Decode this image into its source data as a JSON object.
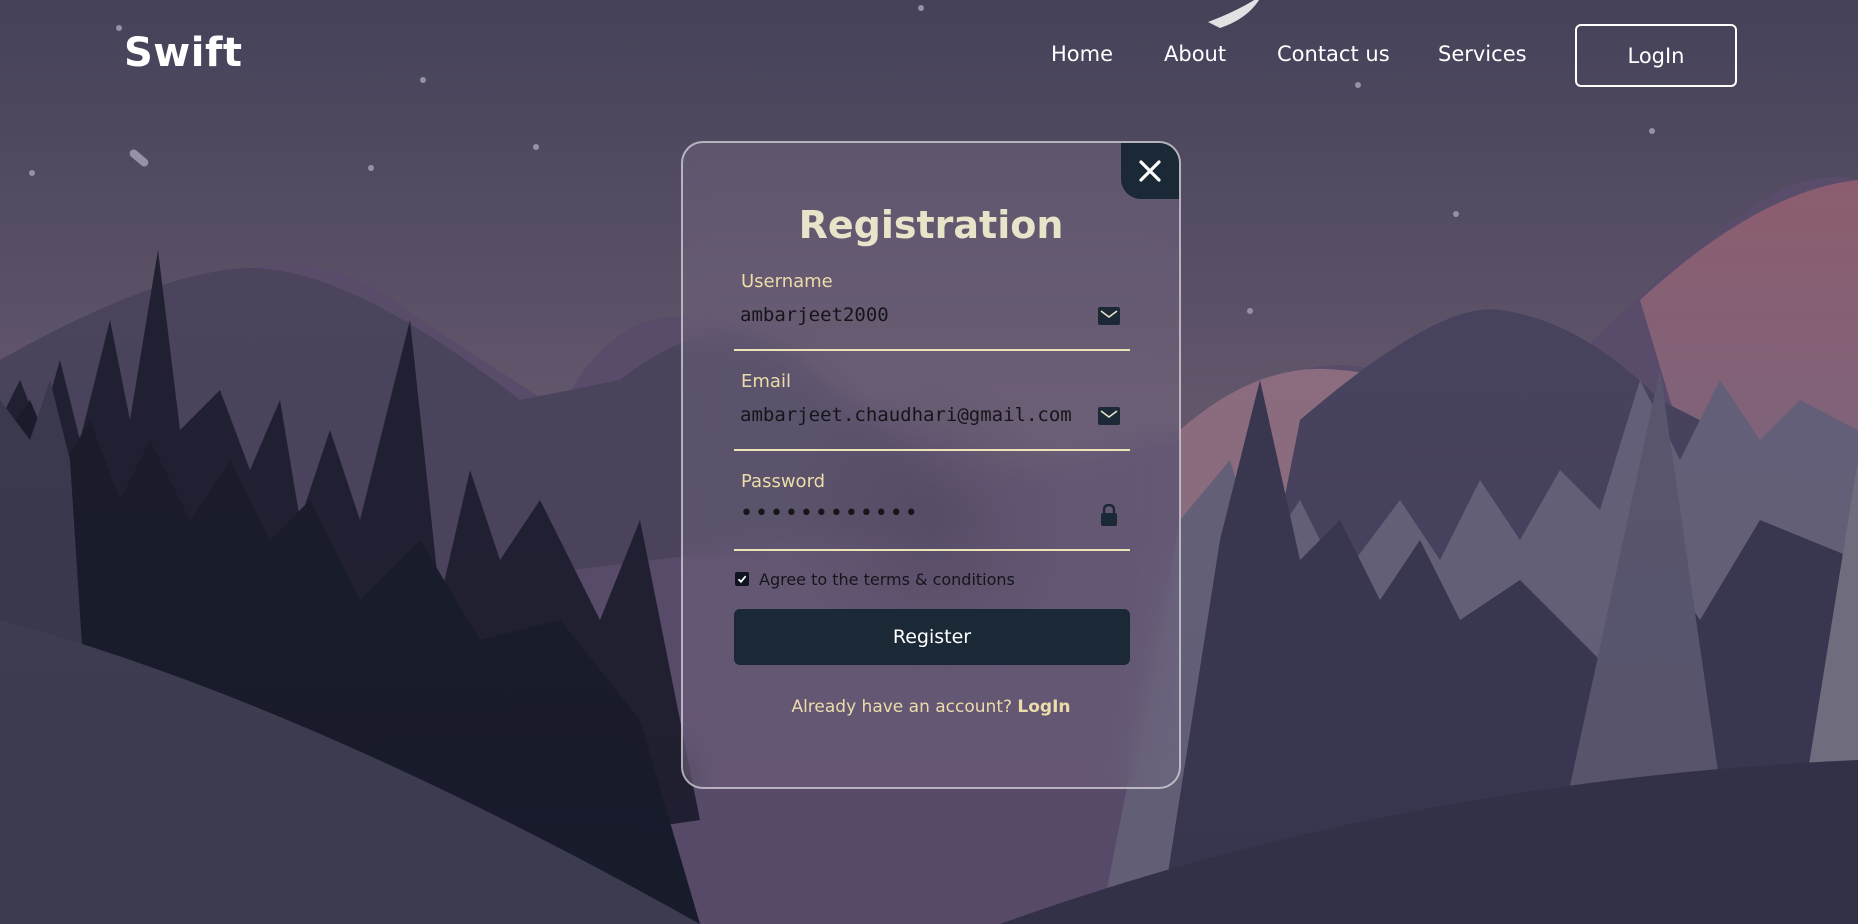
{
  "header": {
    "logo": "Swift",
    "nav": [
      "Home",
      "About",
      "Contact us",
      "Services"
    ],
    "login_button": "LogIn"
  },
  "modal": {
    "title": "Registration",
    "fields": [
      {
        "label": "Username",
        "value": "ambarjeet2000",
        "icon": "mail-icon"
      },
      {
        "label": "Email",
        "value": "ambarjeet.chaudhari@gmail.com",
        "icon": "mail-icon"
      },
      {
        "label": "Password",
        "value": "••••••••••••",
        "icon": "lock-icon"
      }
    ],
    "terms_label": "Agree to the terms & conditions",
    "terms_checked": true,
    "register_button": "Register",
    "already_text": "Already have an account?",
    "login_link": "LogIn"
  },
  "colors": {
    "accent_dark": "#1b2836",
    "label_cream": "#ecdcaa",
    "title_cream": "#e8e4c9"
  }
}
